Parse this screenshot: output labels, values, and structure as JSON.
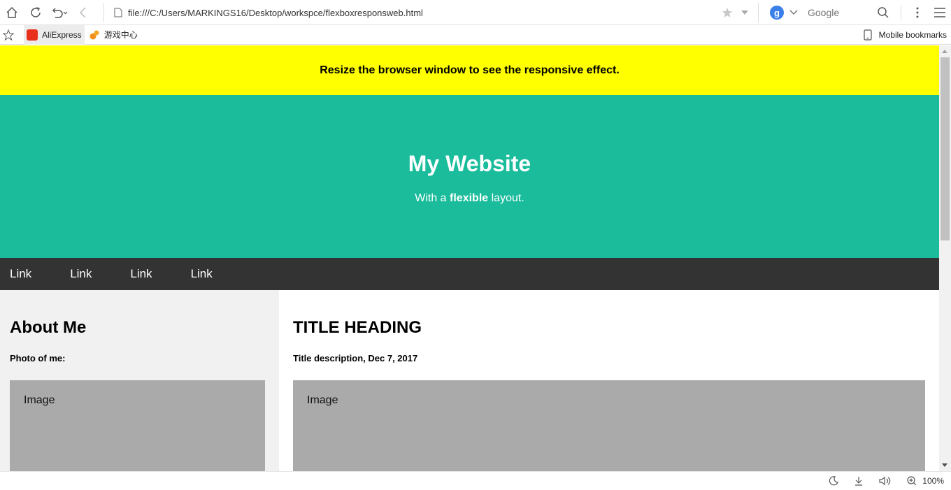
{
  "browser": {
    "url": "file:///C:/Users/MARKINGS16/Desktop/workspce/flexboxresponsweb.html",
    "search_engine": "Google",
    "search_engine_letter": "g",
    "bookmarks": [
      {
        "label": "AliExpress"
      },
      {
        "label": "游戏中心"
      }
    ],
    "mobile_bookmarks": "Mobile bookmarks",
    "zoom": "100%"
  },
  "page": {
    "banner": "Resize the browser window to see the responsive effect.",
    "header": {
      "title": "My Website",
      "subtitle_pre": "With a ",
      "subtitle_bold": "flexible",
      "subtitle_post": " layout."
    },
    "nav": [
      "Link",
      "Link",
      "Link",
      "Link"
    ],
    "side": {
      "heading": "About Me",
      "subheading": "Photo of me:",
      "image_label": "Image"
    },
    "main": {
      "heading": "TITLE HEADING",
      "subheading": "Title description, Dec 7, 2017",
      "image_label": "Image"
    }
  },
  "colors": {
    "banner": "#ffff00",
    "header": "#1abc9c",
    "navbar": "#333333",
    "side": "#f1f1f1",
    "placeholder": "#aaaaaa"
  }
}
